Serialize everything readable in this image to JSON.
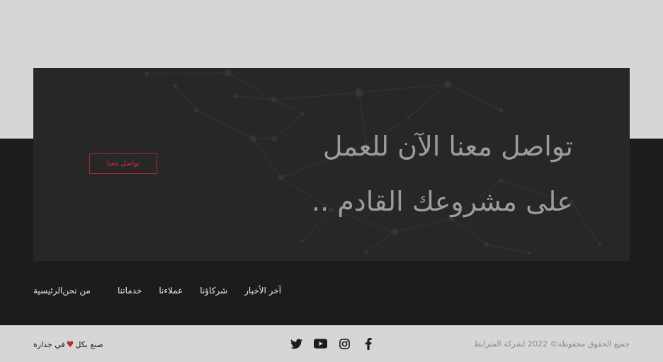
{
  "cta": {
    "heading_line1": "تواصل معنا الآن للعمل",
    "heading_line2": "على مشروعك القادم ..",
    "button_label": "تواصل معنا"
  },
  "nav": {
    "items": [
      {
        "label": "الرئيسية"
      },
      {
        "label": "من نحن"
      },
      {
        "label": "خدماتنا"
      },
      {
        "label": "عملاءنا"
      },
      {
        "label": "شركاؤنا"
      },
      {
        "label": "آخر الأخبار"
      }
    ]
  },
  "footer": {
    "copyright": "جميع الحقوق محفوظة© 2022 لشركة المترابط",
    "made_prefix": "صنع بكل",
    "made_suffix": "في جدارة",
    "heart_glyph": "♥",
    "socials": [
      "facebook-icon",
      "instagram-icon",
      "youtube-icon",
      "twitter-icon"
    ]
  },
  "colors": {
    "accent": "#c0262d",
    "dark_band": "#1c1c1c",
    "card": "#272727",
    "light_band": "#d6d6d6"
  }
}
